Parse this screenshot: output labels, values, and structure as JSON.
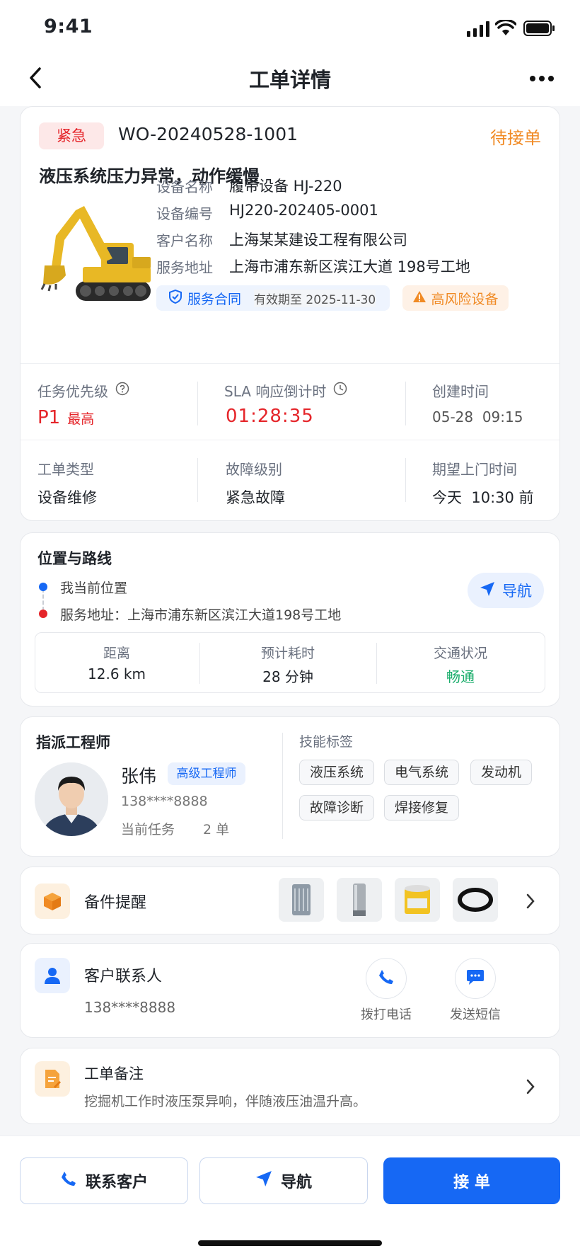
{
  "status_bar": {
    "time": "9:41"
  },
  "nav": {
    "title": "工单详情"
  },
  "order": {
    "urgency": "紧急",
    "id": "WO-20240528-1001",
    "status": "待接单",
    "fault_title": "液压系统压力异常，动作缓慢",
    "fields": [
      {
        "label": "设备名称",
        "value": "履带设备 HJ-220"
      },
      {
        "label": "设备编号",
        "value": "HJ220-202405-0001"
      },
      {
        "label": "客户名称",
        "value": "上海某某建设工程有限公司"
      },
      {
        "label": "服务地址",
        "value": "上海市浦东新区滨江大道 198号工地"
      }
    ],
    "contract_label": "服务合同",
    "contract_validity": "有效期至 2025-11-30",
    "risk_label": "高风险设备"
  },
  "metrics": {
    "priority_label": "任务优先级",
    "priority_value": "P1",
    "priority_text": "最高",
    "sla_label": "SLA 响应倒计时",
    "sla_value": "01:28:35",
    "created_label": "创建时间",
    "created_value": "05-28  09:15",
    "type_label": "工单类型",
    "type_value": "设备维修",
    "fault_level_label": "故障级别",
    "fault_level_value": "紧急故障",
    "expected_label": "期望上门时间",
    "expected_value": "今天  10:30 前"
  },
  "location": {
    "title": "位置与路线",
    "my_location": "我当前位置",
    "service_address": "服务地址：上海市浦东新区滨江大道198号工地",
    "nav_label": "导航",
    "distance_label": "距离",
    "distance_value": "12.6 km",
    "eta_label": "预计耗时",
    "eta_value": "28 分钟",
    "traffic_label": "交通状况",
    "traffic_value": "畅通"
  },
  "engineer": {
    "title": "指派工程师",
    "name": "张伟",
    "level": "高级工程师",
    "phone": "138****8888",
    "task_label": "当前任务",
    "task_value": "2 单",
    "skills_title": "技能标签",
    "skills": [
      "液压系统",
      "电气系统",
      "发动机",
      "故障诊断",
      "焊接修复"
    ]
  },
  "parts": {
    "title": "备件提醒"
  },
  "contact": {
    "title": "客户联系人",
    "phone": "138****8888",
    "call_label": "拨打电话",
    "sms_label": "发送短信"
  },
  "remark": {
    "title": "工单备注",
    "text": "挖掘机工作时液压泵异响，伴随液压油温升高。"
  },
  "actions": {
    "contact_label": "联系客户",
    "navigate_label": "导航",
    "accept_label": "接 单"
  },
  "colors": {
    "primary": "#1668F4",
    "danger": "#E5252A",
    "warning": "#F08A24",
    "success": "#1AAD6B"
  }
}
